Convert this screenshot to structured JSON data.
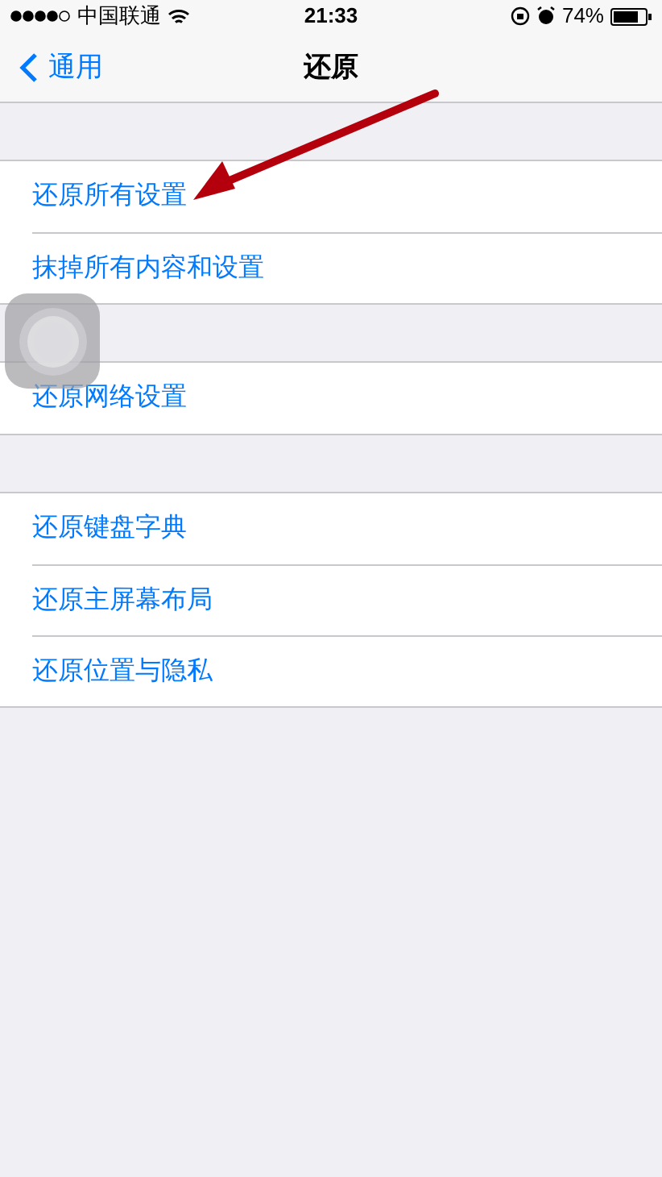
{
  "status_bar": {
    "carrier": "中国联通",
    "time": "21:33",
    "battery": "74%"
  },
  "nav": {
    "back": "通用",
    "title": "还原"
  },
  "groups": [
    {
      "rows": [
        {
          "label": "还原所有设置"
        },
        {
          "label": "抹掉所有内容和设置"
        }
      ]
    },
    {
      "rows": [
        {
          "label": "还原网络设置"
        }
      ]
    },
    {
      "rows": [
        {
          "label": "还原键盘字典"
        },
        {
          "label": "还原主屏幕布局"
        },
        {
          "label": "还原位置与隐私"
        }
      ]
    }
  ]
}
